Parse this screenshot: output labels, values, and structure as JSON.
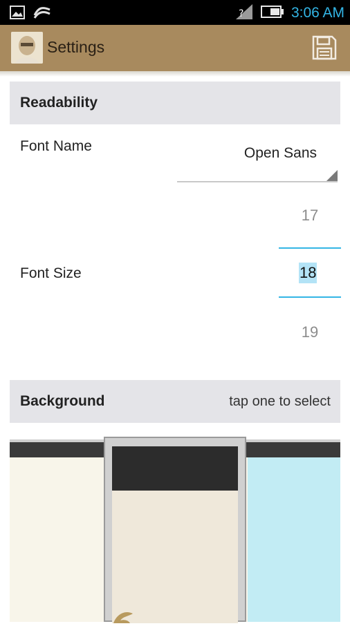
{
  "status_bar": {
    "time": "3:06 AM",
    "icons": [
      "image-icon",
      "swype-icon",
      "no-signal-icon",
      "battery-icon"
    ]
  },
  "action_bar": {
    "title": "Settings",
    "save_icon": "save-icon"
  },
  "readability": {
    "header": "Readability",
    "font_name_label": "Font Name",
    "font_name_value": "Open Sans",
    "font_size_label": "Font Size",
    "font_size_prev": "17",
    "font_size_current": "18",
    "font_size_next": "19"
  },
  "background": {
    "header": "Background",
    "hint": "tap one to select",
    "options": [
      "cream",
      "parchment",
      "light-blue"
    ],
    "selected": "parchment"
  },
  "colors": {
    "accent": "#33b5e5",
    "action_bar": "#a88a5e",
    "section_header": "#e4e4e8"
  }
}
